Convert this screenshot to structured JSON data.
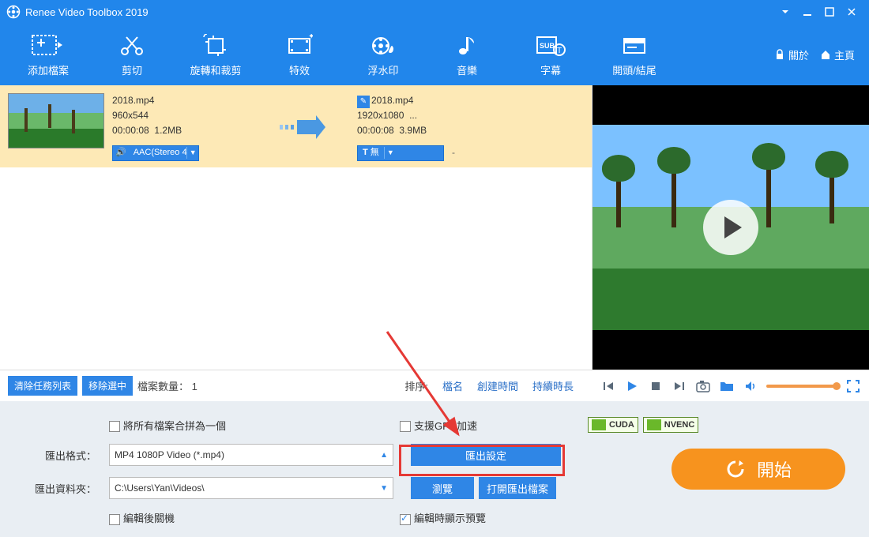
{
  "title": "Renee Video Toolbox 2019",
  "toolbar": {
    "add": "添加檔案",
    "cut": "剪切",
    "rotate": "旋轉和裁剪",
    "fx": "特效",
    "watermark": "浮水印",
    "music": "音樂",
    "subtitle": "字幕",
    "introoutro": "開頭/結尾",
    "about": "關於",
    "home": "主頁"
  },
  "file": {
    "name": "2018.mp4",
    "res": "960x544",
    "dur": "00:00:08",
    "size": "1.2MB",
    "out_name": "2018.mp4",
    "out_res": "1920x1080",
    "out_more": "...",
    "out_dur": "00:00:08",
    "out_size": "3.9MB",
    "audio_sel": "AAC(Stereo 4",
    "sub_sel": "無",
    "sub_prefix": "T"
  },
  "midbar": {
    "clear": "清除任務列表",
    "remove": "移除選中",
    "count_label": "檔案數量：",
    "count_val": "1",
    "sort_label": "排序:",
    "by_name": "檔名",
    "by_created": "創建時間",
    "by_duration": "持續時長"
  },
  "bottom": {
    "merge": "將所有檔案合拼為一個",
    "gpu": "支援GPU加速",
    "cuda": "CUDA",
    "nvenc": "NVENC",
    "format_label": "匯出格式：",
    "format_val": "MP4 1080P Video (*.mp4)",
    "export_settings": "匯出設定",
    "folder_label": "匯出資料夾：",
    "folder_val": "C:\\Users\\Yan\\Videos\\",
    "browse": "瀏覽",
    "open_export": "打開匯出檔案",
    "shutdown": "編輯後關機",
    "preview_after": "編輯時顯示預覽",
    "start": "開始"
  }
}
